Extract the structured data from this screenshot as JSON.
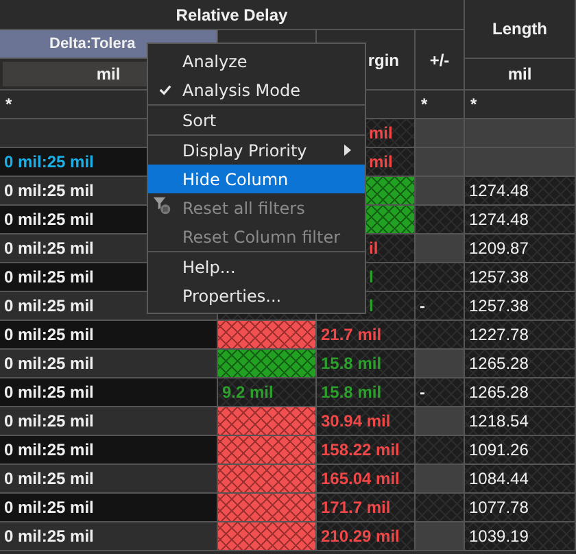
{
  "header": {
    "group_title": "Relative Delay",
    "delta_column": {
      "label": "Delta:Tolera",
      "selected": true
    },
    "margin_column": "rgin",
    "plus_minus_column": "+/-",
    "length_column": "Length",
    "delta_unit": "mil",
    "length_unit": "mil",
    "delta_filter": "*",
    "plus_minus_filter": "*",
    "length_filter": "*"
  },
  "rows": [
    {
      "col3": "mil",
      "col3_failed": true
    },
    {
      "delta": "0 mil:25 mil",
      "delta_highlight": true,
      "col3": "mil",
      "col3_failed": true
    },
    {
      "delta": "0 mil:25 mil",
      "col3_filled": true,
      "col3_failed": false,
      "length": "1274.48"
    },
    {
      "delta": "0 mil:25 mil",
      "col3_filled": true,
      "col3_failed": false,
      "col4_hatched": true,
      "length": "1274.48"
    },
    {
      "delta": "0 mil:25 mil",
      "col3": "il",
      "col3_failed": true,
      "length": "1209.87"
    },
    {
      "delta": "0 mil:25 mil",
      "col3": "l",
      "col3_failed": false,
      "col4_hatched": true,
      "length": "1257.38"
    },
    {
      "delta": "0 mil:25 mil",
      "col3": "l",
      "col3_failed": false,
      "col4": "-",
      "col4_hatched": true,
      "length": "1257.38"
    },
    {
      "delta": "0 mil:25 mil",
      "col2_filled": true,
      "col2_failed": true,
      "col3": "21.7 mil",
      "col3_failed": true,
      "col4_hatched": true,
      "length": "1227.78"
    },
    {
      "delta": "0 mil:25 mil",
      "col2_filled": true,
      "col2_failed": false,
      "col3": "15.8 mil",
      "col3_failed": false,
      "length": "1265.28"
    },
    {
      "delta": "0 mil:25 mil",
      "col2": "9.2 mil",
      "col2_failed": false,
      "col3": "15.8 mil",
      "col3_failed": false,
      "col4": "-",
      "col4_hatched": true,
      "length": "1265.28"
    },
    {
      "delta": "0 mil:25 mil",
      "col2_filled": true,
      "col2_failed": true,
      "col3": "30.94 mil",
      "col3_failed": true,
      "length": "1218.54"
    },
    {
      "delta": "0 mil:25 mil",
      "col2_filled": true,
      "col2_failed": true,
      "col3": "158.22 mil",
      "col3_failed": true,
      "col4_hatched": true,
      "length": "1091.26"
    },
    {
      "delta": "0 mil:25 mil",
      "col2_filled": true,
      "col2_failed": true,
      "col3": "165.04 mil",
      "col3_failed": true,
      "length": "1084.44"
    },
    {
      "delta": "0 mil:25 mil",
      "col2_filled": true,
      "col2_failed": true,
      "col3": "171.7 mil",
      "col3_failed": true,
      "col4_hatched": true,
      "length": "1077.78"
    },
    {
      "delta": "0 mil:25 mil",
      "col2_filled": true,
      "col2_failed": true,
      "col3": "210.29 mil",
      "col3_failed": true,
      "length": "1039.19"
    }
  ],
  "menu": {
    "items": [
      {
        "kind": "item",
        "label": "Analyze",
        "checked": false,
        "selected": false,
        "disabled": false
      },
      {
        "kind": "item",
        "label": "Analysis Mode",
        "checked": true,
        "selected": false,
        "disabled": false
      },
      {
        "kind": "separator"
      },
      {
        "kind": "item",
        "label": "Sort",
        "checked": false,
        "selected": false,
        "disabled": false
      },
      {
        "kind": "separator"
      },
      {
        "kind": "item",
        "label": "Display Priority",
        "checked": false,
        "selected": false,
        "disabled": false,
        "has_submenu": true
      },
      {
        "kind": "item",
        "label": "Hide Column",
        "checked": false,
        "selected": true,
        "disabled": false
      },
      {
        "kind": "item",
        "label": "Reset all filters",
        "checked": false,
        "selected": false,
        "disabled": true,
        "has_icon": true
      },
      {
        "kind": "item",
        "label": "Reset Column filter",
        "checked": false,
        "selected": false,
        "disabled": true
      },
      {
        "kind": "separator"
      },
      {
        "kind": "item",
        "label": "Help...",
        "checked": false,
        "selected": false,
        "disabled": false
      },
      {
        "kind": "item",
        "label": "Properties...",
        "checked": false,
        "selected": false,
        "disabled": false
      }
    ]
  }
}
